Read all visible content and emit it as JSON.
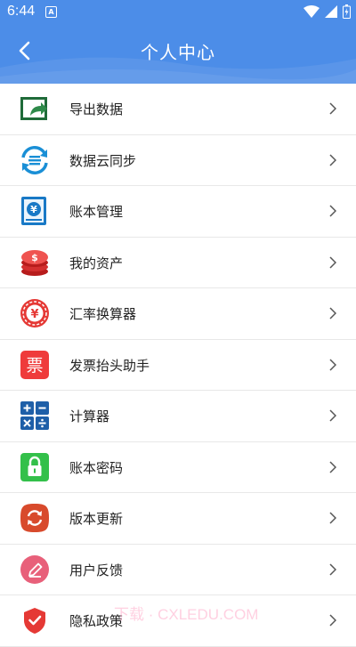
{
  "status_bar": {
    "time": "6:44",
    "notification_badge": "A"
  },
  "header": {
    "title": "个人中心"
  },
  "menu": [
    {
      "label": "导出数据",
      "icon": "export-data-icon"
    },
    {
      "label": "数据云同步",
      "icon": "cloud-sync-icon"
    },
    {
      "label": "账本管理",
      "icon": "ledger-management-icon"
    },
    {
      "label": "我的资产",
      "icon": "assets-coins-icon"
    },
    {
      "label": "汇率换算器",
      "icon": "exchange-rate-icon"
    },
    {
      "label": "发票抬头助手",
      "icon": "invoice-icon"
    },
    {
      "label": "计算器",
      "icon": "calculator-icon"
    },
    {
      "label": "账本密码",
      "icon": "lock-icon"
    },
    {
      "label": "版本更新",
      "icon": "update-icon"
    },
    {
      "label": "用户反馈",
      "icon": "feedback-pencil-icon"
    },
    {
      "label": "隐私政策",
      "icon": "privacy-shield-icon"
    }
  ],
  "watermark": "下载 · CXLEDU.COM",
  "colors": {
    "header": "#4c8de8",
    "divider": "#e8e8e8"
  }
}
